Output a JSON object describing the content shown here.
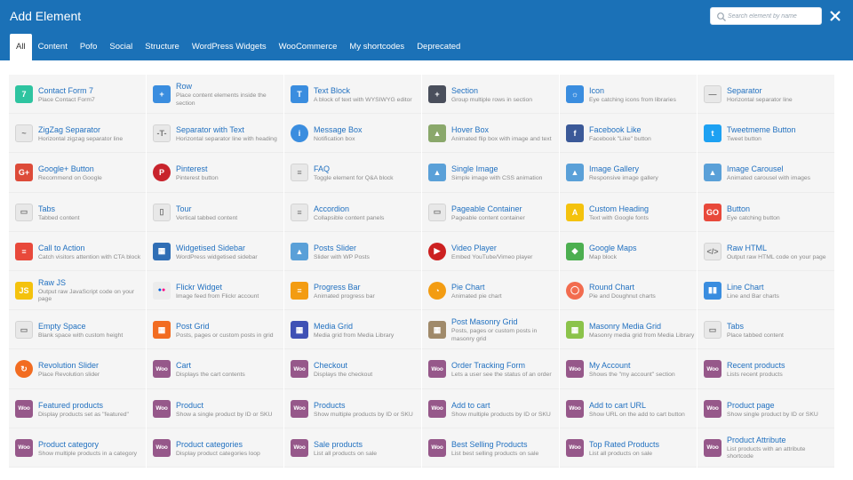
{
  "header": {
    "title": "Add Element",
    "search_placeholder": "Search element by name",
    "bg_color": "#1b71b7"
  },
  "tabs": [
    {
      "label": "All",
      "active": true
    },
    {
      "label": "Content"
    },
    {
      "label": "Pofo"
    },
    {
      "label": "Social"
    },
    {
      "label": "Structure"
    },
    {
      "label": "WordPress Widgets"
    },
    {
      "label": "WooCommerce"
    },
    {
      "label": "My shortcodes"
    },
    {
      "label": "Deprecated"
    }
  ],
  "elements": [
    {
      "name": "Contact Form 7",
      "desc": "Place Contact Form7",
      "icon": "contact-form-icon",
      "color": "#2ec4a0",
      "glyph": "7"
    },
    {
      "name": "Row",
      "desc": "Place content elements inside the section",
      "icon": "row-icon",
      "color": "#3a8ddf",
      "glyph": "+"
    },
    {
      "name": "Text Block",
      "desc": "A block of text with WYSIWYG editor",
      "icon": "text-block-icon",
      "color": "#3a8ddf",
      "glyph": "T"
    },
    {
      "name": "Section",
      "desc": "Group multiple rows in section",
      "icon": "section-icon",
      "color": "#4a4f5c",
      "glyph": "+"
    },
    {
      "name": "Icon",
      "desc": "Eye catching icons from libraries",
      "icon": "icon-element-icon",
      "color": "#3a8ddf",
      "glyph": "☼"
    },
    {
      "name": "Separator",
      "desc": "Horizontal separator line",
      "icon": "separator-icon",
      "color": "#e8e8e8",
      "glyph": "—",
      "dark": true
    },
    {
      "name": "ZigZag Separator",
      "desc": "Horizontal zigzag separator line",
      "icon": "zigzag-separator-icon",
      "color": "#e8e8e8",
      "glyph": "~",
      "dark": true
    },
    {
      "name": "Separator with Text",
      "desc": "Horizontal separator line with heading",
      "icon": "separator-text-icon",
      "color": "#e8e8e8",
      "glyph": "-T-",
      "dark": true
    },
    {
      "name": "Message Box",
      "desc": "Notification box",
      "icon": "message-box-icon",
      "color": "#3a8ddf",
      "glyph": "i",
      "round": true
    },
    {
      "name": "Hover Box",
      "desc": "Animated flip box with image and text",
      "icon": "hover-box-icon",
      "color": "#8aa86b",
      "glyph": "▲"
    },
    {
      "name": "Facebook Like",
      "desc": "Facebook \"Like\" button",
      "icon": "facebook-icon",
      "color": "#3b5998",
      "glyph": "f"
    },
    {
      "name": "Tweetmeme Button",
      "desc": "Tweet button",
      "icon": "twitter-icon",
      "color": "#1da1f2",
      "glyph": "t"
    },
    {
      "name": "Google+ Button",
      "desc": "Recommend on Google",
      "icon": "google-plus-icon",
      "color": "#dd4b39",
      "glyph": "G+"
    },
    {
      "name": "Pinterest",
      "desc": "Pinterest button",
      "icon": "pinterest-icon",
      "color": "#c8232c",
      "glyph": "P",
      "round": true
    },
    {
      "name": "FAQ",
      "desc": "Toggle element for Q&A block",
      "icon": "faq-icon",
      "color": "#e8e8e8",
      "glyph": "≡",
      "dark": true
    },
    {
      "name": "Single Image",
      "desc": "Simple image with CSS animation",
      "icon": "single-image-icon",
      "color": "#5aa0d8",
      "glyph": "▲"
    },
    {
      "name": "Image Gallery",
      "desc": "Responsive image gallery",
      "icon": "image-gallery-icon",
      "color": "#5aa0d8",
      "glyph": "▲"
    },
    {
      "name": "Image Carousel",
      "desc": "Animated carousel with images",
      "icon": "image-carousel-icon",
      "color": "#5aa0d8",
      "glyph": "▲"
    },
    {
      "name": "Tabs",
      "desc": "Tabbed content",
      "icon": "tabs-icon",
      "color": "#e8e8e8",
      "glyph": "▭",
      "dark": true
    },
    {
      "name": "Tour",
      "desc": "Vertical tabbed content",
      "icon": "tour-icon",
      "color": "#e8e8e8",
      "glyph": "▯",
      "dark": true
    },
    {
      "name": "Accordion",
      "desc": "Collapsible content panels",
      "icon": "accordion-icon",
      "color": "#e8e8e8",
      "glyph": "≡",
      "dark": true
    },
    {
      "name": "Pageable Container",
      "desc": "Pageable content container",
      "icon": "pageable-container-icon",
      "color": "#e8e8e8",
      "glyph": "▭",
      "dark": true
    },
    {
      "name": "Custom Heading",
      "desc": "Text with Google fonts",
      "icon": "custom-heading-icon",
      "color": "#f4c20d",
      "glyph": "A"
    },
    {
      "name": "Button",
      "desc": "Eye catching button",
      "icon": "button-icon",
      "color": "#e8493b",
      "glyph": "GO"
    },
    {
      "name": "Call to Action",
      "desc": "Catch visitors attention with CTA block",
      "icon": "call-to-action-icon",
      "color": "#e8493b",
      "glyph": "≡"
    },
    {
      "name": "Widgetised Sidebar",
      "desc": "WordPress widgetised sidebar",
      "icon": "widgetised-sidebar-icon",
      "color": "#2f6eb5",
      "glyph": "▦"
    },
    {
      "name": "Posts Slider",
      "desc": "Slider with WP Posts",
      "icon": "posts-slider-icon",
      "color": "#5aa0d8",
      "glyph": "▲"
    },
    {
      "name": "Video Player",
      "desc": "Embed YouTube/Vimeo player",
      "icon": "video-player-icon",
      "color": "#cc2020",
      "glyph": "▶",
      "round": true
    },
    {
      "name": "Google Maps",
      "desc": "Map block",
      "icon": "google-maps-icon",
      "color": "#4caf50",
      "glyph": "◆"
    },
    {
      "name": "Raw HTML",
      "desc": "Output raw HTML code on your page",
      "icon": "raw-html-icon",
      "color": "#e8e8e8",
      "glyph": "</>",
      "dark": true
    },
    {
      "name": "Raw JS",
      "desc": "Output raw JavaScript code on your page",
      "icon": "raw-js-icon",
      "color": "#f4c20d",
      "glyph": "JS"
    },
    {
      "name": "Flickr Widget",
      "desc": "Image feed from Flickr account",
      "icon": "flickr-icon",
      "color": "#ececec",
      "glyph": "●●",
      "flickr": true
    },
    {
      "name": "Progress Bar",
      "desc": "Animated progress bar",
      "icon": "progress-bar-icon",
      "color": "#f39c12",
      "glyph": "≡"
    },
    {
      "name": "Pie Chart",
      "desc": "Animated pie chart",
      "icon": "pie-chart-icon",
      "color": "#f39c12",
      "glyph": "◔",
      "round": true
    },
    {
      "name": "Round Chart",
      "desc": "Pie and Doughnut charts",
      "icon": "round-chart-icon",
      "color": "#f26c4f",
      "glyph": "◯",
      "round": true
    },
    {
      "name": "Line Chart",
      "desc": "Line and Bar charts",
      "icon": "line-chart-icon",
      "color": "#3a8ddf",
      "glyph": "▮▮"
    },
    {
      "name": "Empty Space",
      "desc": "Blank space with custom height",
      "icon": "empty-space-icon",
      "color": "#e8e8e8",
      "glyph": "▭",
      "dark": true
    },
    {
      "name": "Post Grid",
      "desc": "Posts, pages or custom posts in grid",
      "icon": "post-grid-icon",
      "color": "#f26c21",
      "glyph": "▦"
    },
    {
      "name": "Media Grid",
      "desc": "Media grid from Media Library",
      "icon": "media-grid-icon",
      "color": "#3f51b5",
      "glyph": "▦"
    },
    {
      "name": "Post Masonry Grid",
      "desc": "Posts, pages or custom posts in masonry grid",
      "icon": "post-masonry-grid-icon",
      "color": "#a08a6a",
      "glyph": "▦"
    },
    {
      "name": "Masonry Media Grid",
      "desc": "Masonry media grid from Media Library",
      "icon": "masonry-media-grid-icon",
      "color": "#8bc34a",
      "glyph": "▦"
    },
    {
      "name": "Tabs",
      "desc": "Place tabbed content",
      "icon": "tabs-icon",
      "color": "#e8e8e8",
      "glyph": "▭",
      "dark": true
    },
    {
      "name": "Revolution Slider",
      "desc": "Place Revolution slider",
      "icon": "revolution-slider-icon",
      "color": "#f26c21",
      "glyph": "↻",
      "round": true
    },
    {
      "name": "Cart",
      "desc": "Displays the cart contents",
      "icon": "woo-icon",
      "color": "#96588a",
      "glyph": "Woo"
    },
    {
      "name": "Checkout",
      "desc": "Displays the checkout",
      "icon": "woo-icon",
      "color": "#96588a",
      "glyph": "Woo"
    },
    {
      "name": "Order Tracking Form",
      "desc": "Lets a user see the status of an order",
      "icon": "woo-icon",
      "color": "#96588a",
      "glyph": "Woo"
    },
    {
      "name": "My Account",
      "desc": "Shows the \"my account\" section",
      "icon": "woo-icon",
      "color": "#96588a",
      "glyph": "Woo"
    },
    {
      "name": "Recent products",
      "desc": "Lists recent products",
      "icon": "woo-icon",
      "color": "#96588a",
      "glyph": "Woo"
    },
    {
      "name": "Featured products",
      "desc": "Display products set as \"featured\"",
      "icon": "woo-icon",
      "color": "#96588a",
      "glyph": "Woo"
    },
    {
      "name": "Product",
      "desc": "Show a single product by ID or SKU",
      "icon": "woo-icon",
      "color": "#96588a",
      "glyph": "Woo"
    },
    {
      "name": "Products",
      "desc": "Show multiple products by ID or SKU",
      "icon": "woo-icon",
      "color": "#96588a",
      "glyph": "Woo"
    },
    {
      "name": "Add to cart",
      "desc": "Show multiple products by ID or SKU",
      "icon": "woo-icon",
      "color": "#96588a",
      "glyph": "Woo"
    },
    {
      "name": "Add to cart URL",
      "desc": "Show URL on the add to cart button",
      "icon": "woo-icon",
      "color": "#96588a",
      "glyph": "Woo"
    },
    {
      "name": "Product page",
      "desc": "Show single product by ID or SKU",
      "icon": "woo-icon",
      "color": "#96588a",
      "glyph": "Woo"
    },
    {
      "name": "Product category",
      "desc": "Show multiple products in a category",
      "icon": "woo-icon",
      "color": "#96588a",
      "glyph": "Woo"
    },
    {
      "name": "Product categories",
      "desc": "Display product categories loop",
      "icon": "woo-icon",
      "color": "#96588a",
      "glyph": "Woo"
    },
    {
      "name": "Sale products",
      "desc": "List all products on sale",
      "icon": "woo-icon",
      "color": "#96588a",
      "glyph": "Woo"
    },
    {
      "name": "Best Selling Products",
      "desc": "List best selling products on sale",
      "icon": "woo-icon",
      "color": "#96588a",
      "glyph": "Woo"
    },
    {
      "name": "Top Rated Products",
      "desc": "List all products on sale",
      "icon": "woo-icon",
      "color": "#96588a",
      "glyph": "Woo"
    },
    {
      "name": "Product Attribute",
      "desc": "List products with an attribute shortcode",
      "icon": "woo-icon",
      "color": "#96588a",
      "glyph": "Woo"
    }
  ]
}
